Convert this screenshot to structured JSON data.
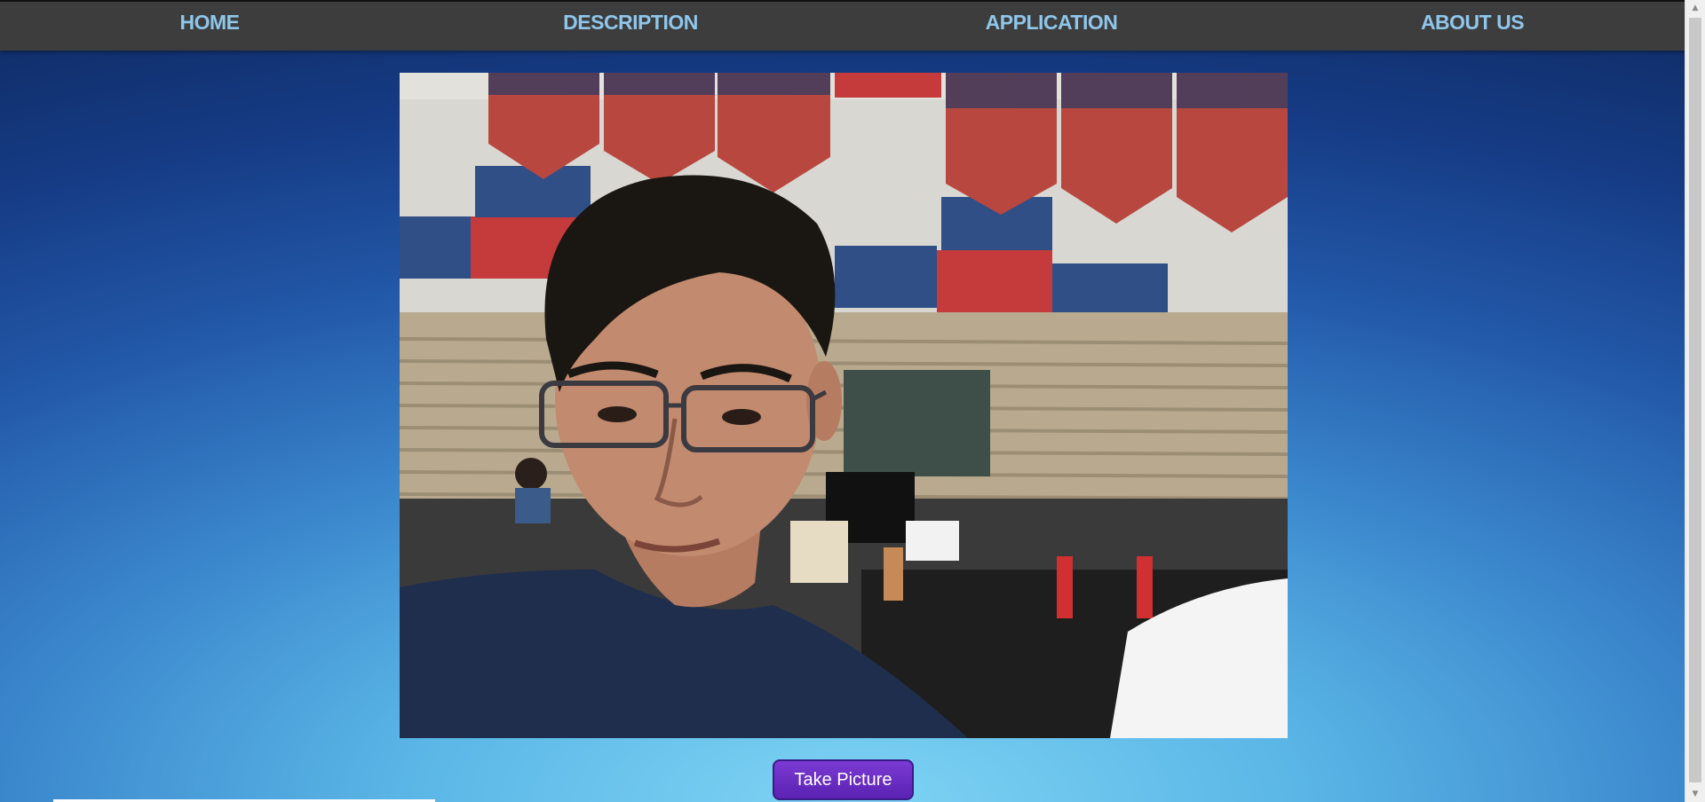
{
  "nav": {
    "items": [
      {
        "label": "HOME"
      },
      {
        "label": "DESCRIPTION"
      },
      {
        "label": "APPLICATION"
      },
      {
        "label": "ABOUT US"
      }
    ]
  },
  "camera": {
    "icon": "webcam-feed",
    "content": "live webcam view"
  },
  "actions": {
    "take_picture_label": "Take Picture"
  },
  "colors": {
    "nav_background": "#3d3d3d",
    "nav_text": "#8fc6ea",
    "button_background": "#6a2ec4",
    "page_gradient_top": "#0e2a62",
    "page_gradient_bottom": "#7fd4f4"
  }
}
